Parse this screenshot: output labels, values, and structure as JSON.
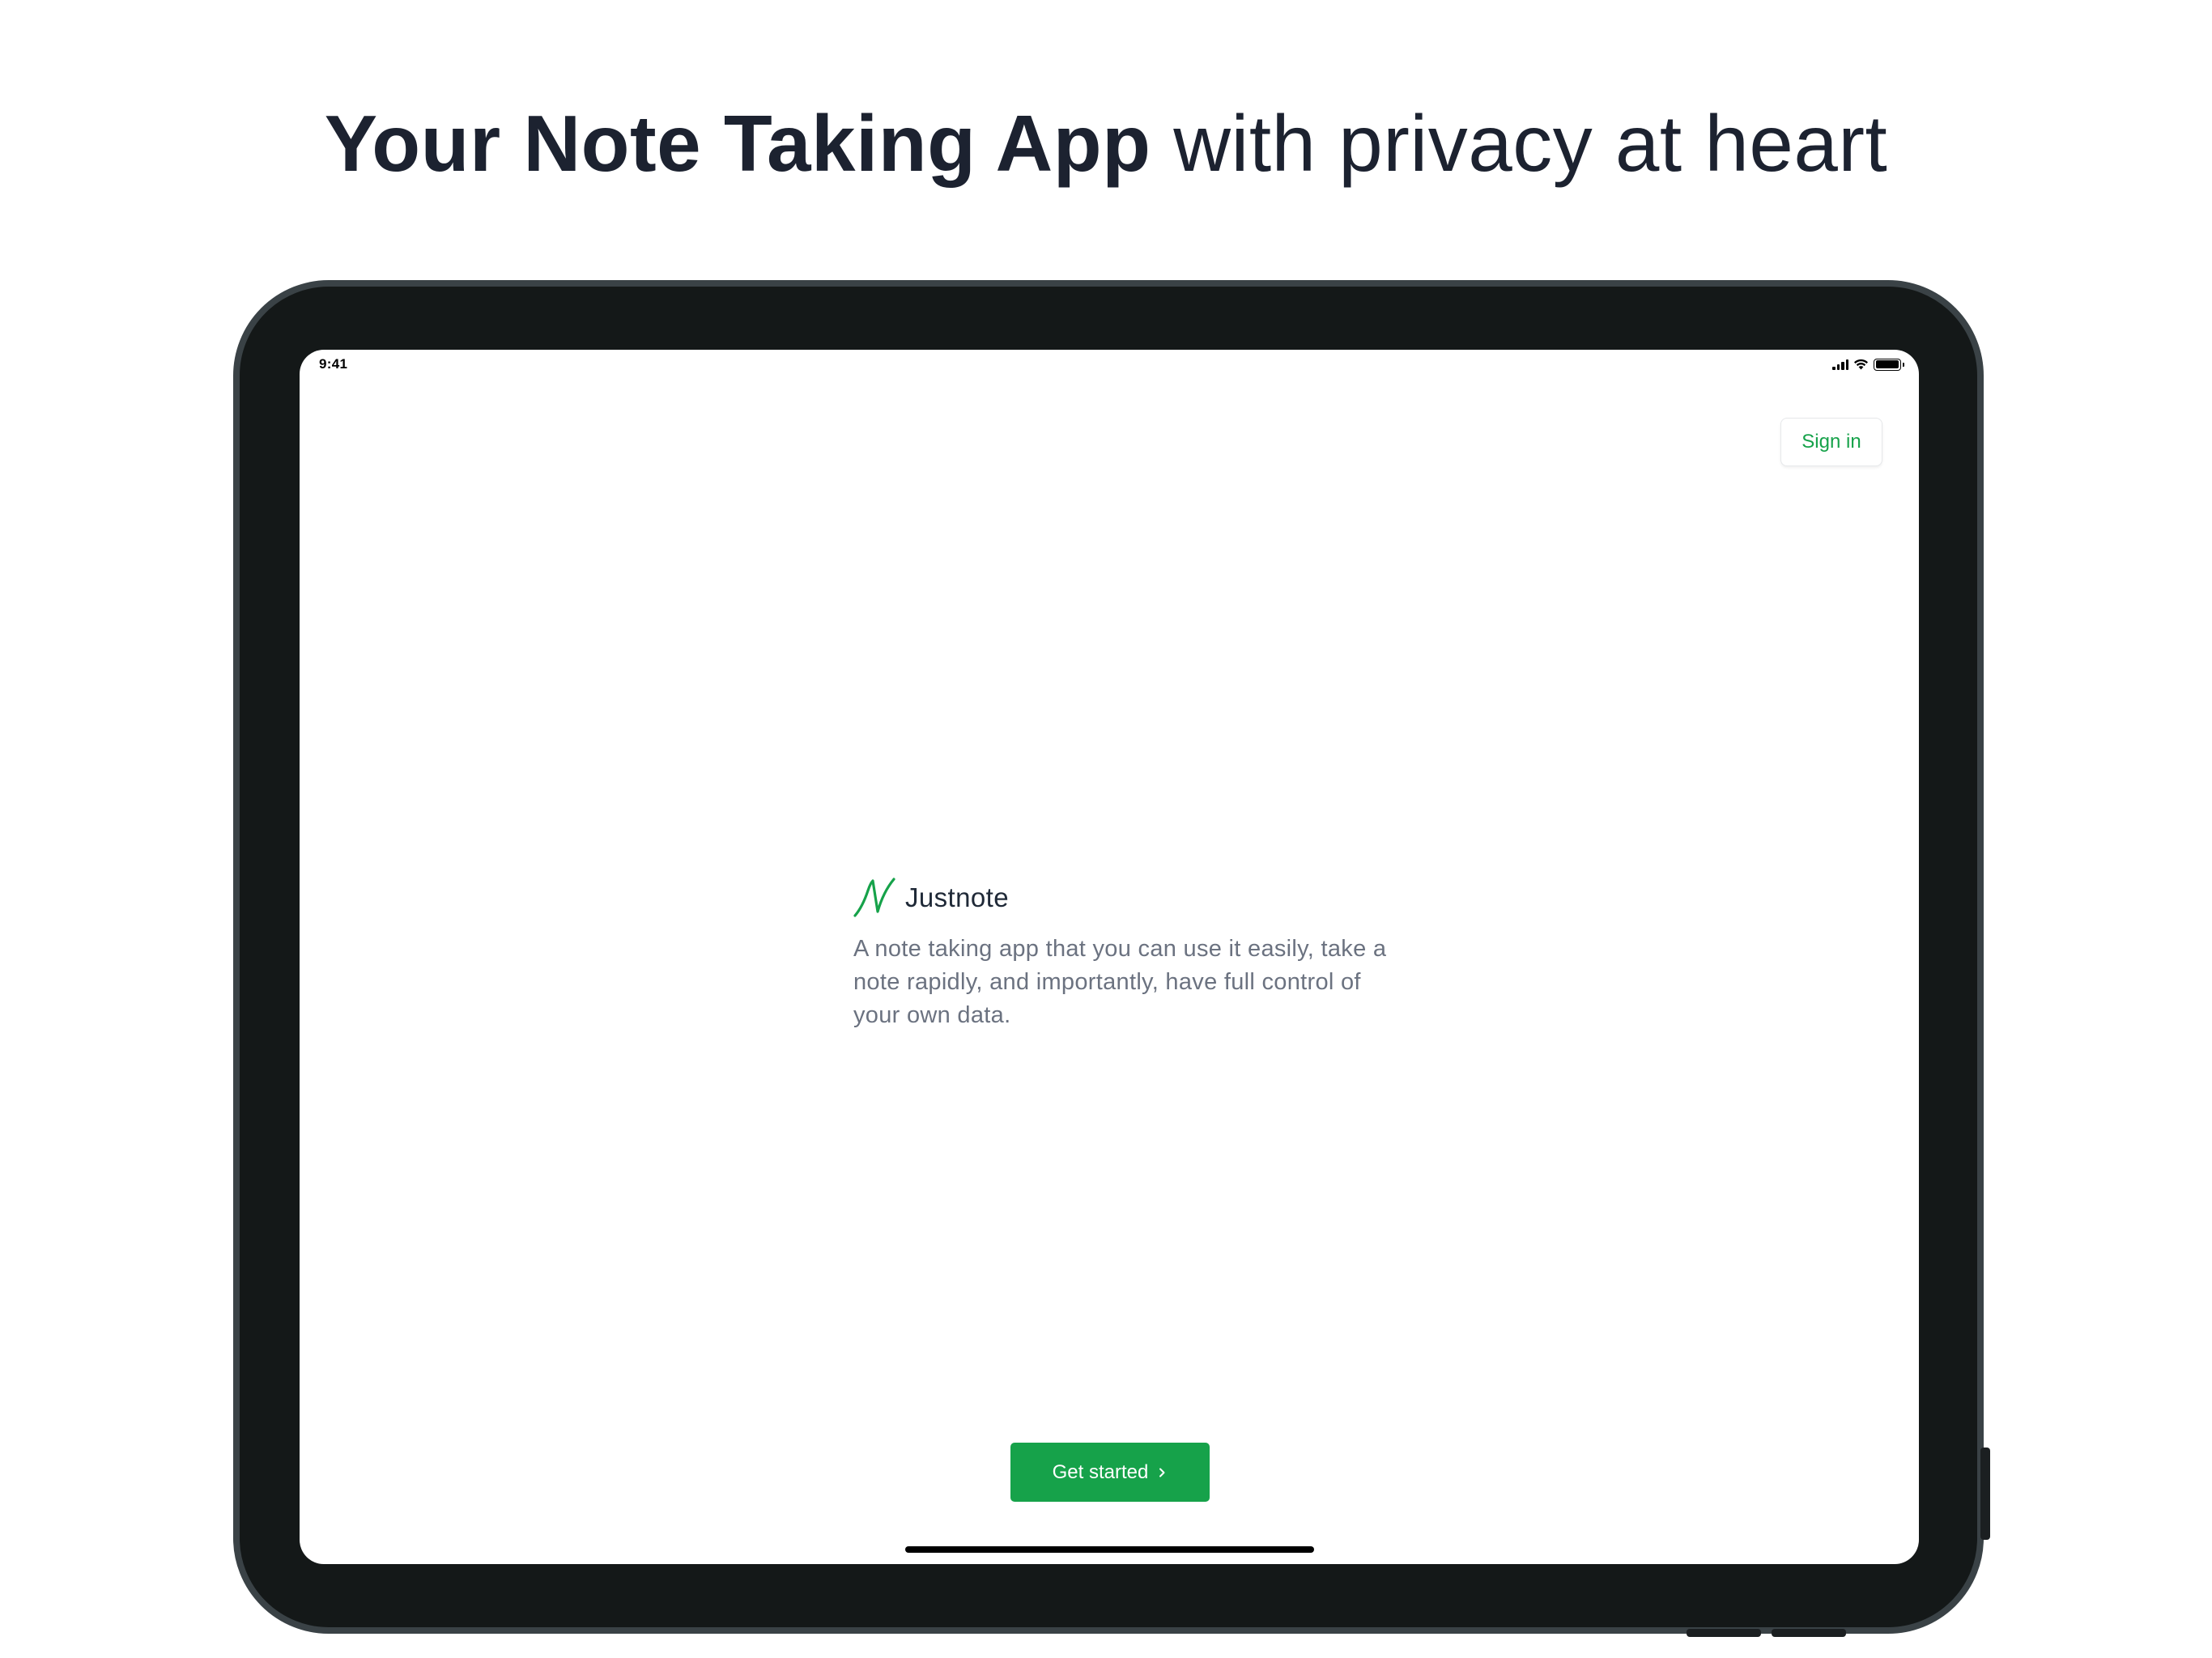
{
  "headline": {
    "bold": "Your Note Taking App",
    "rest": "with privacy at heart"
  },
  "status_bar": {
    "time": "9:41",
    "icons": [
      "signal-icon",
      "wifi-icon",
      "battery-icon"
    ]
  },
  "header": {
    "sign_in_label": "Sign in"
  },
  "brand": {
    "logo_icon": "justnote-logo-icon",
    "name": "Justnote",
    "description": "A note taking app that you can use it easily, take a note rapidly, and importantly, have full control of your own data."
  },
  "cta": {
    "label": "Get started",
    "icon": "chevron-right-icon"
  },
  "colors": {
    "accent": "#16a24a",
    "headline": "#1c2230",
    "body_text": "#6b7280",
    "device_frame": "#141818"
  }
}
